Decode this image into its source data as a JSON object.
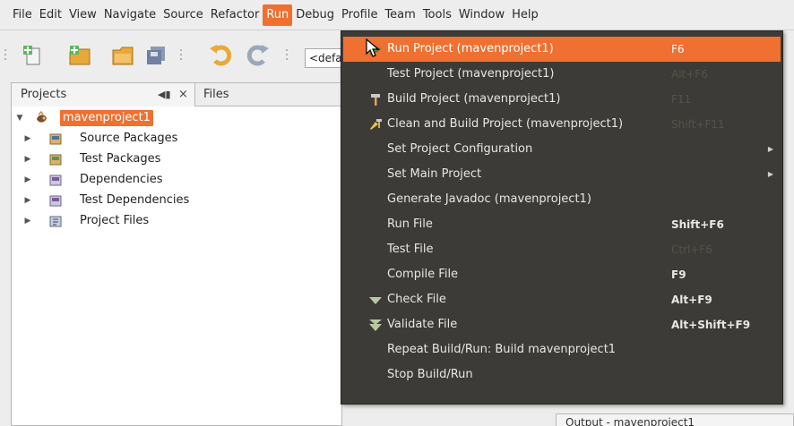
{
  "menubar": {
    "items": [
      "File",
      "Edit",
      "View",
      "Navigate",
      "Source",
      "Refactor",
      "Run",
      "Debug",
      "Profile",
      "Team",
      "Tools",
      "Window",
      "Help"
    ]
  },
  "toolbar": {
    "config_value": "<default config>"
  },
  "projects_panel": {
    "tab_projects": "Projects",
    "tab_files": "Files",
    "root": "mavenproject1",
    "nodes": [
      "Source Packages",
      "Test Packages",
      "Dependencies",
      "Test Dependencies",
      "Project Files"
    ]
  },
  "output": {
    "title": "Output - mavenproject1"
  },
  "run_menu": {
    "items": [
      {
        "label": "Run Project (mavenproject1)",
        "shortcut": "F6"
      },
      {
        "label": "Test Project (mavenproject1)",
        "shortcut": "Alt+F6"
      },
      {
        "label": "Build Project (mavenproject1)",
        "shortcut": "F11"
      },
      {
        "label": "Clean and Build Project (mavenproject1)",
        "shortcut": "Shift+F11"
      },
      {
        "label": "Set Project Configuration",
        "shortcut": ""
      },
      {
        "label": "Set Main Project",
        "shortcut": ""
      },
      {
        "label": "Generate Javadoc (mavenproject1)",
        "shortcut": ""
      },
      {
        "label": "Run File",
        "shortcut": "Shift+F6"
      },
      {
        "label": "Test File",
        "shortcut": "Ctrl+F6"
      },
      {
        "label": "Compile File",
        "shortcut": "F9"
      },
      {
        "label": "Check File",
        "shortcut": "Alt+F9"
      },
      {
        "label": "Validate File",
        "shortcut": "Alt+Shift+F9"
      },
      {
        "label": "Repeat Build/Run: Build mavenproject1",
        "shortcut": ""
      },
      {
        "label": "Stop Build/Run",
        "shortcut": ""
      }
    ]
  },
  "colors": {
    "accent": "#ef7030",
    "menu_bg": "#3c3b37",
    "menu_text": "#e6e6e6",
    "disabled_text": "#545349"
  }
}
